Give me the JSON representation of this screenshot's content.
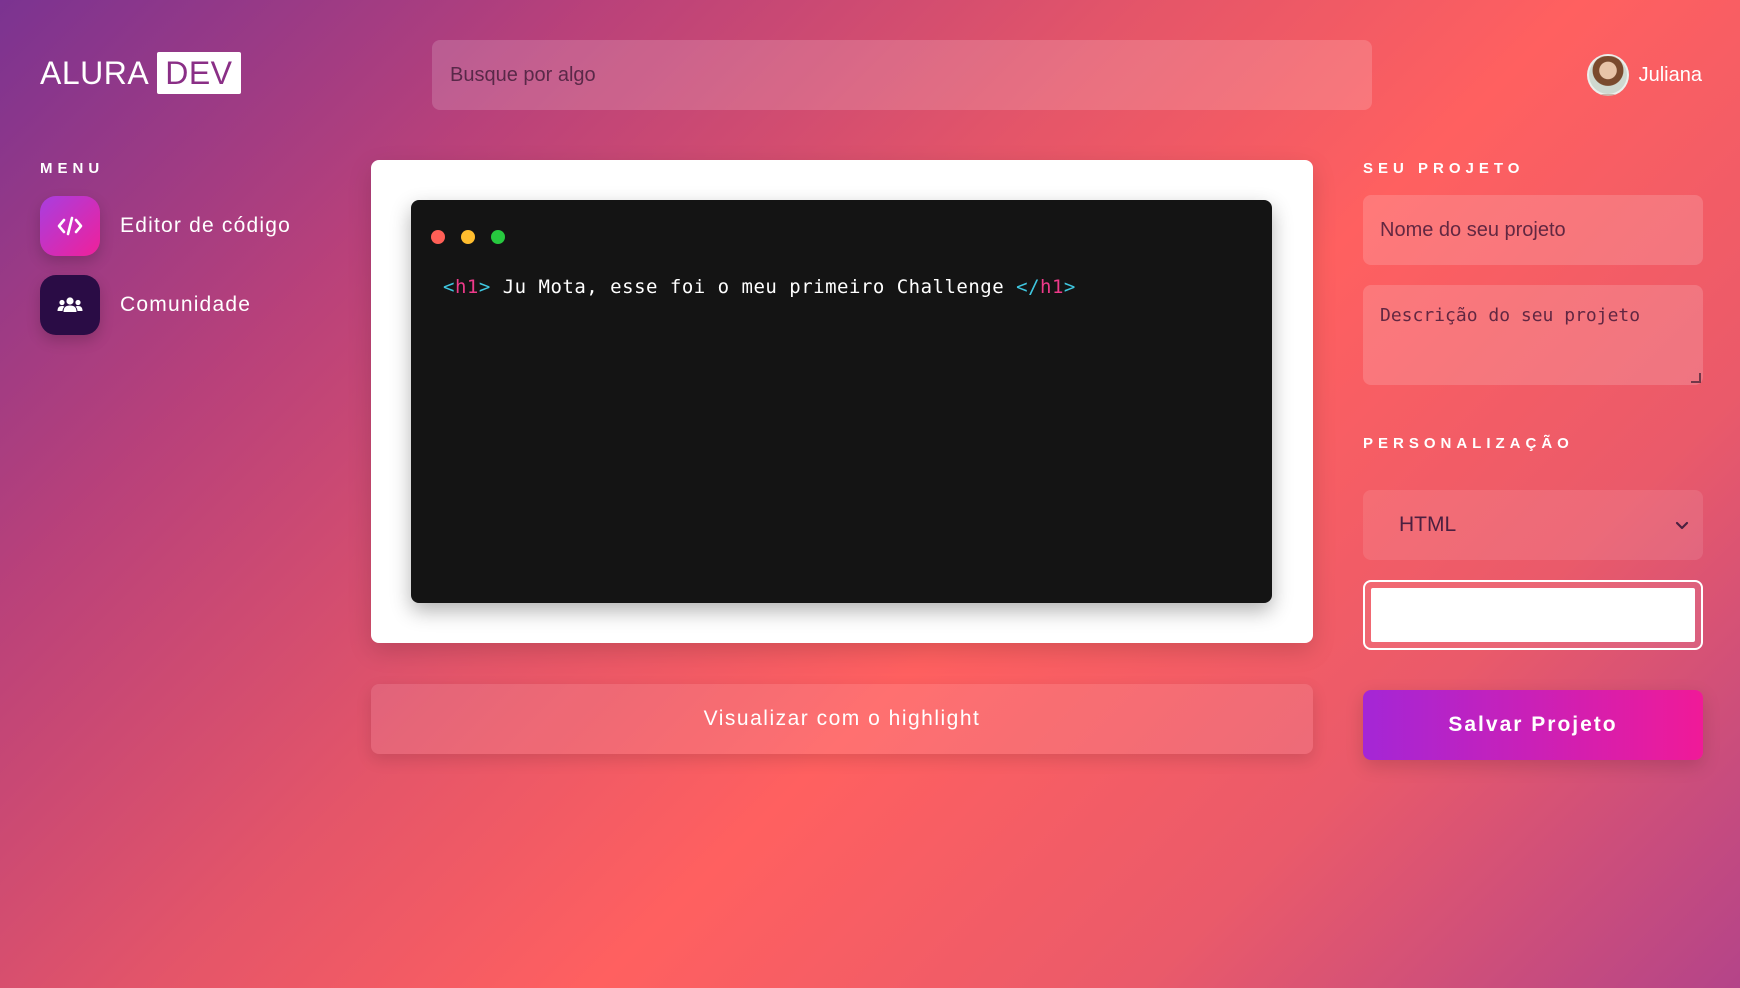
{
  "header": {
    "logo_text": "ALURA",
    "logo_badge": "DEV",
    "search_placeholder": "Busque por algo",
    "user_name": "Juliana"
  },
  "sidebar": {
    "title": "MENU",
    "items": [
      {
        "label": "Editor de código",
        "icon": "code-icon"
      },
      {
        "label": "Comunidade",
        "icon": "users-icon"
      }
    ]
  },
  "editor": {
    "code": {
      "open_bracket": "<",
      "open_tag": "h1",
      "open_close_bracket": ">",
      "text": " Ju Mota, esse foi o meu primeiro Challenge ",
      "close_bracket": "</",
      "close_tag": "h1",
      "close_close_bracket": ">"
    },
    "preview_button": "Visualizar com o highlight"
  },
  "project": {
    "title": "SEU PROJETO",
    "name_placeholder": "Nome do seu projeto",
    "description_placeholder": "Descrição do seu projeto"
  },
  "customization": {
    "title": "PERSONALIZAÇÃO",
    "language_selected": "HTML",
    "color_value": "#ffffff"
  },
  "save_button": "Salvar Projeto",
  "colors": {
    "accent_gradient_start": "#a426d6",
    "accent_gradient_end": "#f01a98",
    "editor_bg": "#141414",
    "tag_color": "#3fc7e0",
    "tag_name_color": "#ee3a8a"
  }
}
